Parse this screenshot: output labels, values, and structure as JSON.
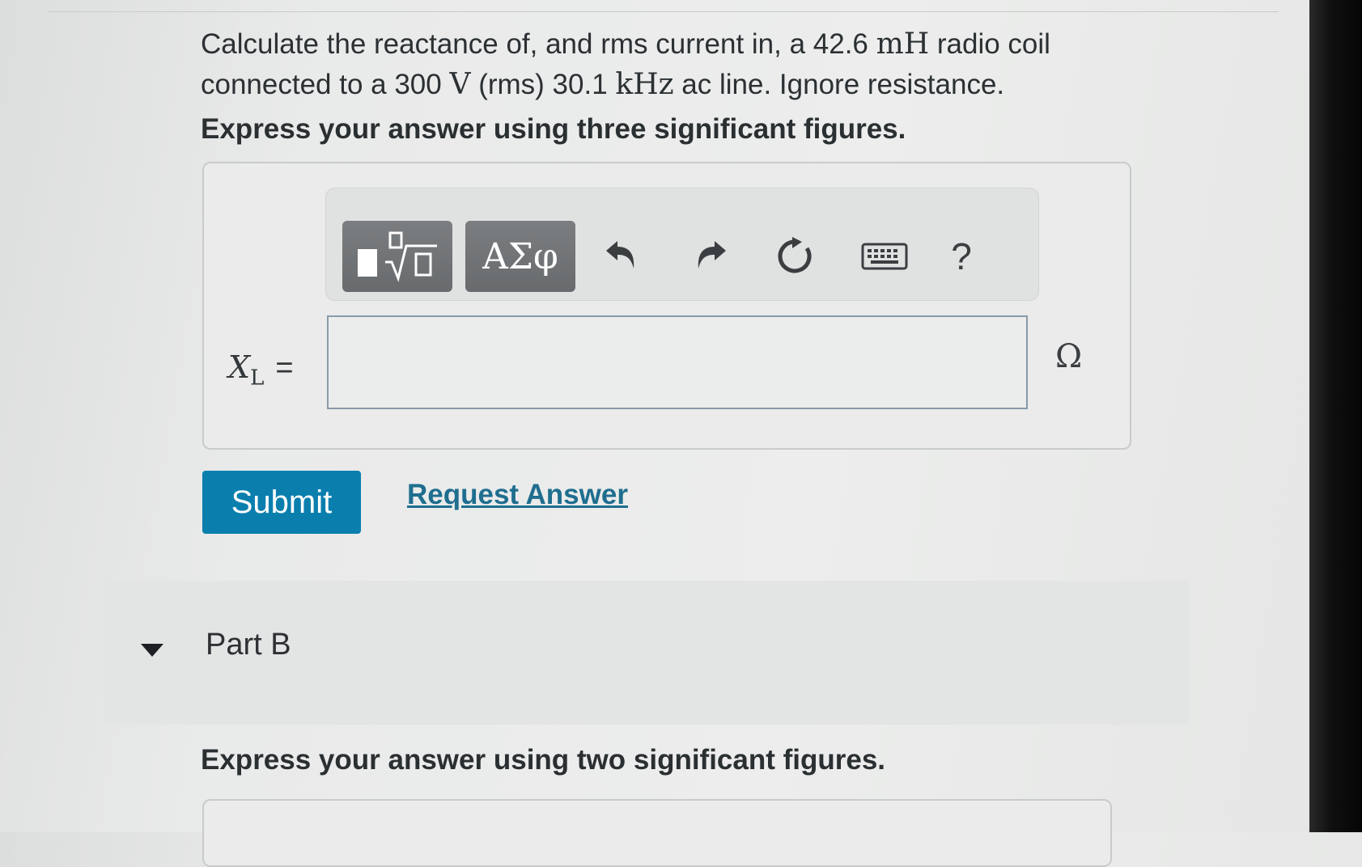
{
  "problem": {
    "t1": "Calculate the reactance of, and rms current in, a 42.6 ",
    "u1": "mH",
    "t2": " radio coil connected to a 300 ",
    "u2": "V",
    "t3": " (rms) 30.1 ",
    "u3": "kHz",
    "t4": " ac line. Ignore resistance."
  },
  "part_a": {
    "instruction": "Express your answer using three significant figures.",
    "toolbar": {
      "templates_icon": "templates-sqrt-icon",
      "greek_label": "ΑΣφ",
      "undo_icon": "undo-icon",
      "redo_icon": "redo-icon",
      "reset_icon": "reset-icon",
      "keyboard_icon": "keyboard-icon",
      "help_label": "?"
    },
    "variable": "X",
    "variable_sub": "L",
    "equals": "=",
    "input_value": "",
    "unit": "Ω",
    "submit_label": "Submit",
    "request_label": "Request Answer"
  },
  "part_b": {
    "title": "Part B",
    "instruction": "Express your answer using two significant figures."
  },
  "colors": {
    "submit_bg": "#0a7fae",
    "link": "#1f6e8f",
    "toolbar_button": "#6f7274"
  }
}
